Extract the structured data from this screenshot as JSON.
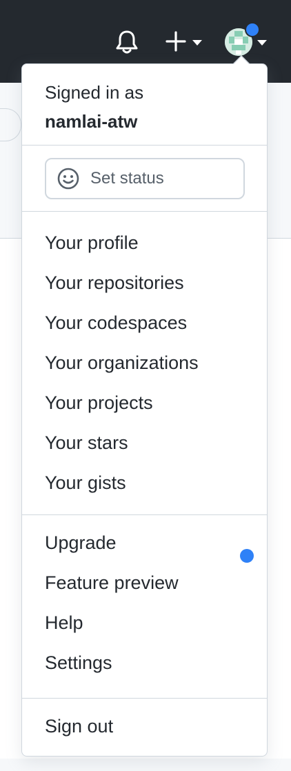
{
  "topbar": {
    "bell_icon": "bell-icon",
    "create_icon": "plus-icon",
    "colors": {
      "background": "#24292f",
      "notification_dot": "#2f81f7"
    }
  },
  "menu": {
    "signed_in_label": "Signed in as",
    "username": "namlai-atw",
    "status_label": "Set status",
    "status_icon": "smiley-icon",
    "section1": [
      "Your profile",
      "Your repositories",
      "Your codespaces",
      "Your organizations",
      "Your projects",
      "Your stars",
      "Your gists"
    ],
    "section2": [
      "Upgrade",
      "Feature preview",
      "Help",
      "Settings"
    ],
    "sign_out": "Sign out",
    "accent_color": "#2f81f7"
  }
}
